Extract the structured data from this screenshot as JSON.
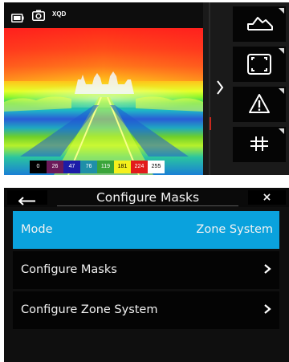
{
  "camera": {
    "status": {
      "battery_icon": "battery-icon",
      "camera_icon": "camera-icon",
      "card_label": "XQD"
    },
    "zone_scale": [
      {
        "value": "0",
        "bg": "#000000",
        "fg": "#ffffff"
      },
      {
        "value": "26",
        "bg": "#6b1a5a",
        "fg": "#ffffff"
      },
      {
        "value": "47",
        "bg": "#1c1ca8",
        "fg": "#ffffff"
      },
      {
        "value": "76",
        "bg": "#1f8fa8",
        "fg": "#ffffff"
      },
      {
        "value": "119",
        "bg": "#3aa53a",
        "fg": "#ffffff"
      },
      {
        "value": "181",
        "bg": "#f5f01c",
        "fg": "#000000"
      },
      {
        "value": "224",
        "bg": "#e21b1b",
        "fg": "#ffffff"
      },
      {
        "value": "255",
        "bg": "#ffffff",
        "fg": "#000000"
      }
    ],
    "tools": [
      {
        "name": "histogram-tool",
        "icon": "waveform-icon"
      },
      {
        "name": "frame-guide-tool",
        "icon": "frame-icon"
      },
      {
        "name": "warning-tool",
        "icon": "warning-icon"
      },
      {
        "name": "grid-tool",
        "icon": "grid-icon"
      }
    ],
    "accent": "#1a8fe0"
  },
  "menu": {
    "back_icon": "back-arrow-icon",
    "title": "Configure Masks",
    "close_label": "×",
    "items": [
      {
        "label": "Mode",
        "value": "Zone System",
        "selected": true
      },
      {
        "label": "Configure Masks",
        "value": "",
        "selected": false
      },
      {
        "label": "Configure Zone System",
        "value": "",
        "selected": false
      }
    ],
    "selected_color": "#0aa2dd"
  }
}
